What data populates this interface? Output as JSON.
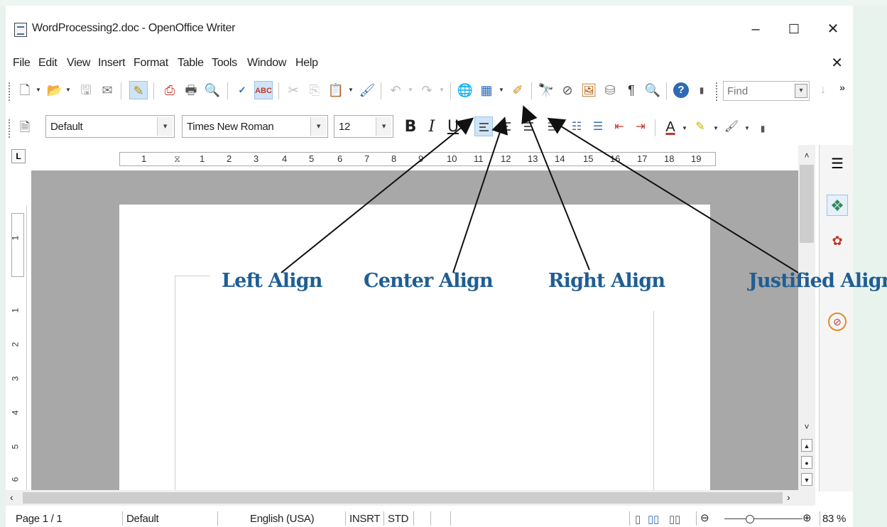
{
  "window": {
    "title": "WordProcessing2.doc - OpenOffice Writer",
    "minimize": "–",
    "maximize": "☐",
    "close": "✕"
  },
  "menu": {
    "items": [
      "File",
      "Edit",
      "View",
      "Insert",
      "Format",
      "Table",
      "Tools",
      "Window",
      "Help"
    ],
    "close_doc": "✕"
  },
  "toolbar": {
    "find_placeholder": "Find"
  },
  "formatting": {
    "paragraph_style": "Default",
    "font_name": "Times New Roman",
    "font_size": "12",
    "bold": "B",
    "italic": "I",
    "underline": "U"
  },
  "ruler": {
    "horizontal_ticks": [
      "1",
      "1",
      "2",
      "3",
      "4",
      "5",
      "6",
      "7",
      "8",
      "9",
      "10",
      "11",
      "12",
      "13",
      "14",
      "15",
      "16",
      "17",
      "18",
      "19"
    ],
    "vertical_ticks": [
      "1",
      "1",
      "2",
      "3",
      "4",
      "5",
      "6"
    ]
  },
  "annotations": {
    "left": "Left Align",
    "center": "Center Align",
    "right": "Right Align",
    "justified": "Justified Align"
  },
  "status": {
    "page": "Page 1 / 1",
    "style": "Default",
    "language": "English (USA)",
    "insert_mode": "INSRT",
    "selection_mode": "STD",
    "zoom": "83 %"
  },
  "icons": {
    "annotation_arrow_color": "#111111",
    "annotation_text_color": "#1f5e93",
    "active_align_bg": "#cfe4f7"
  }
}
